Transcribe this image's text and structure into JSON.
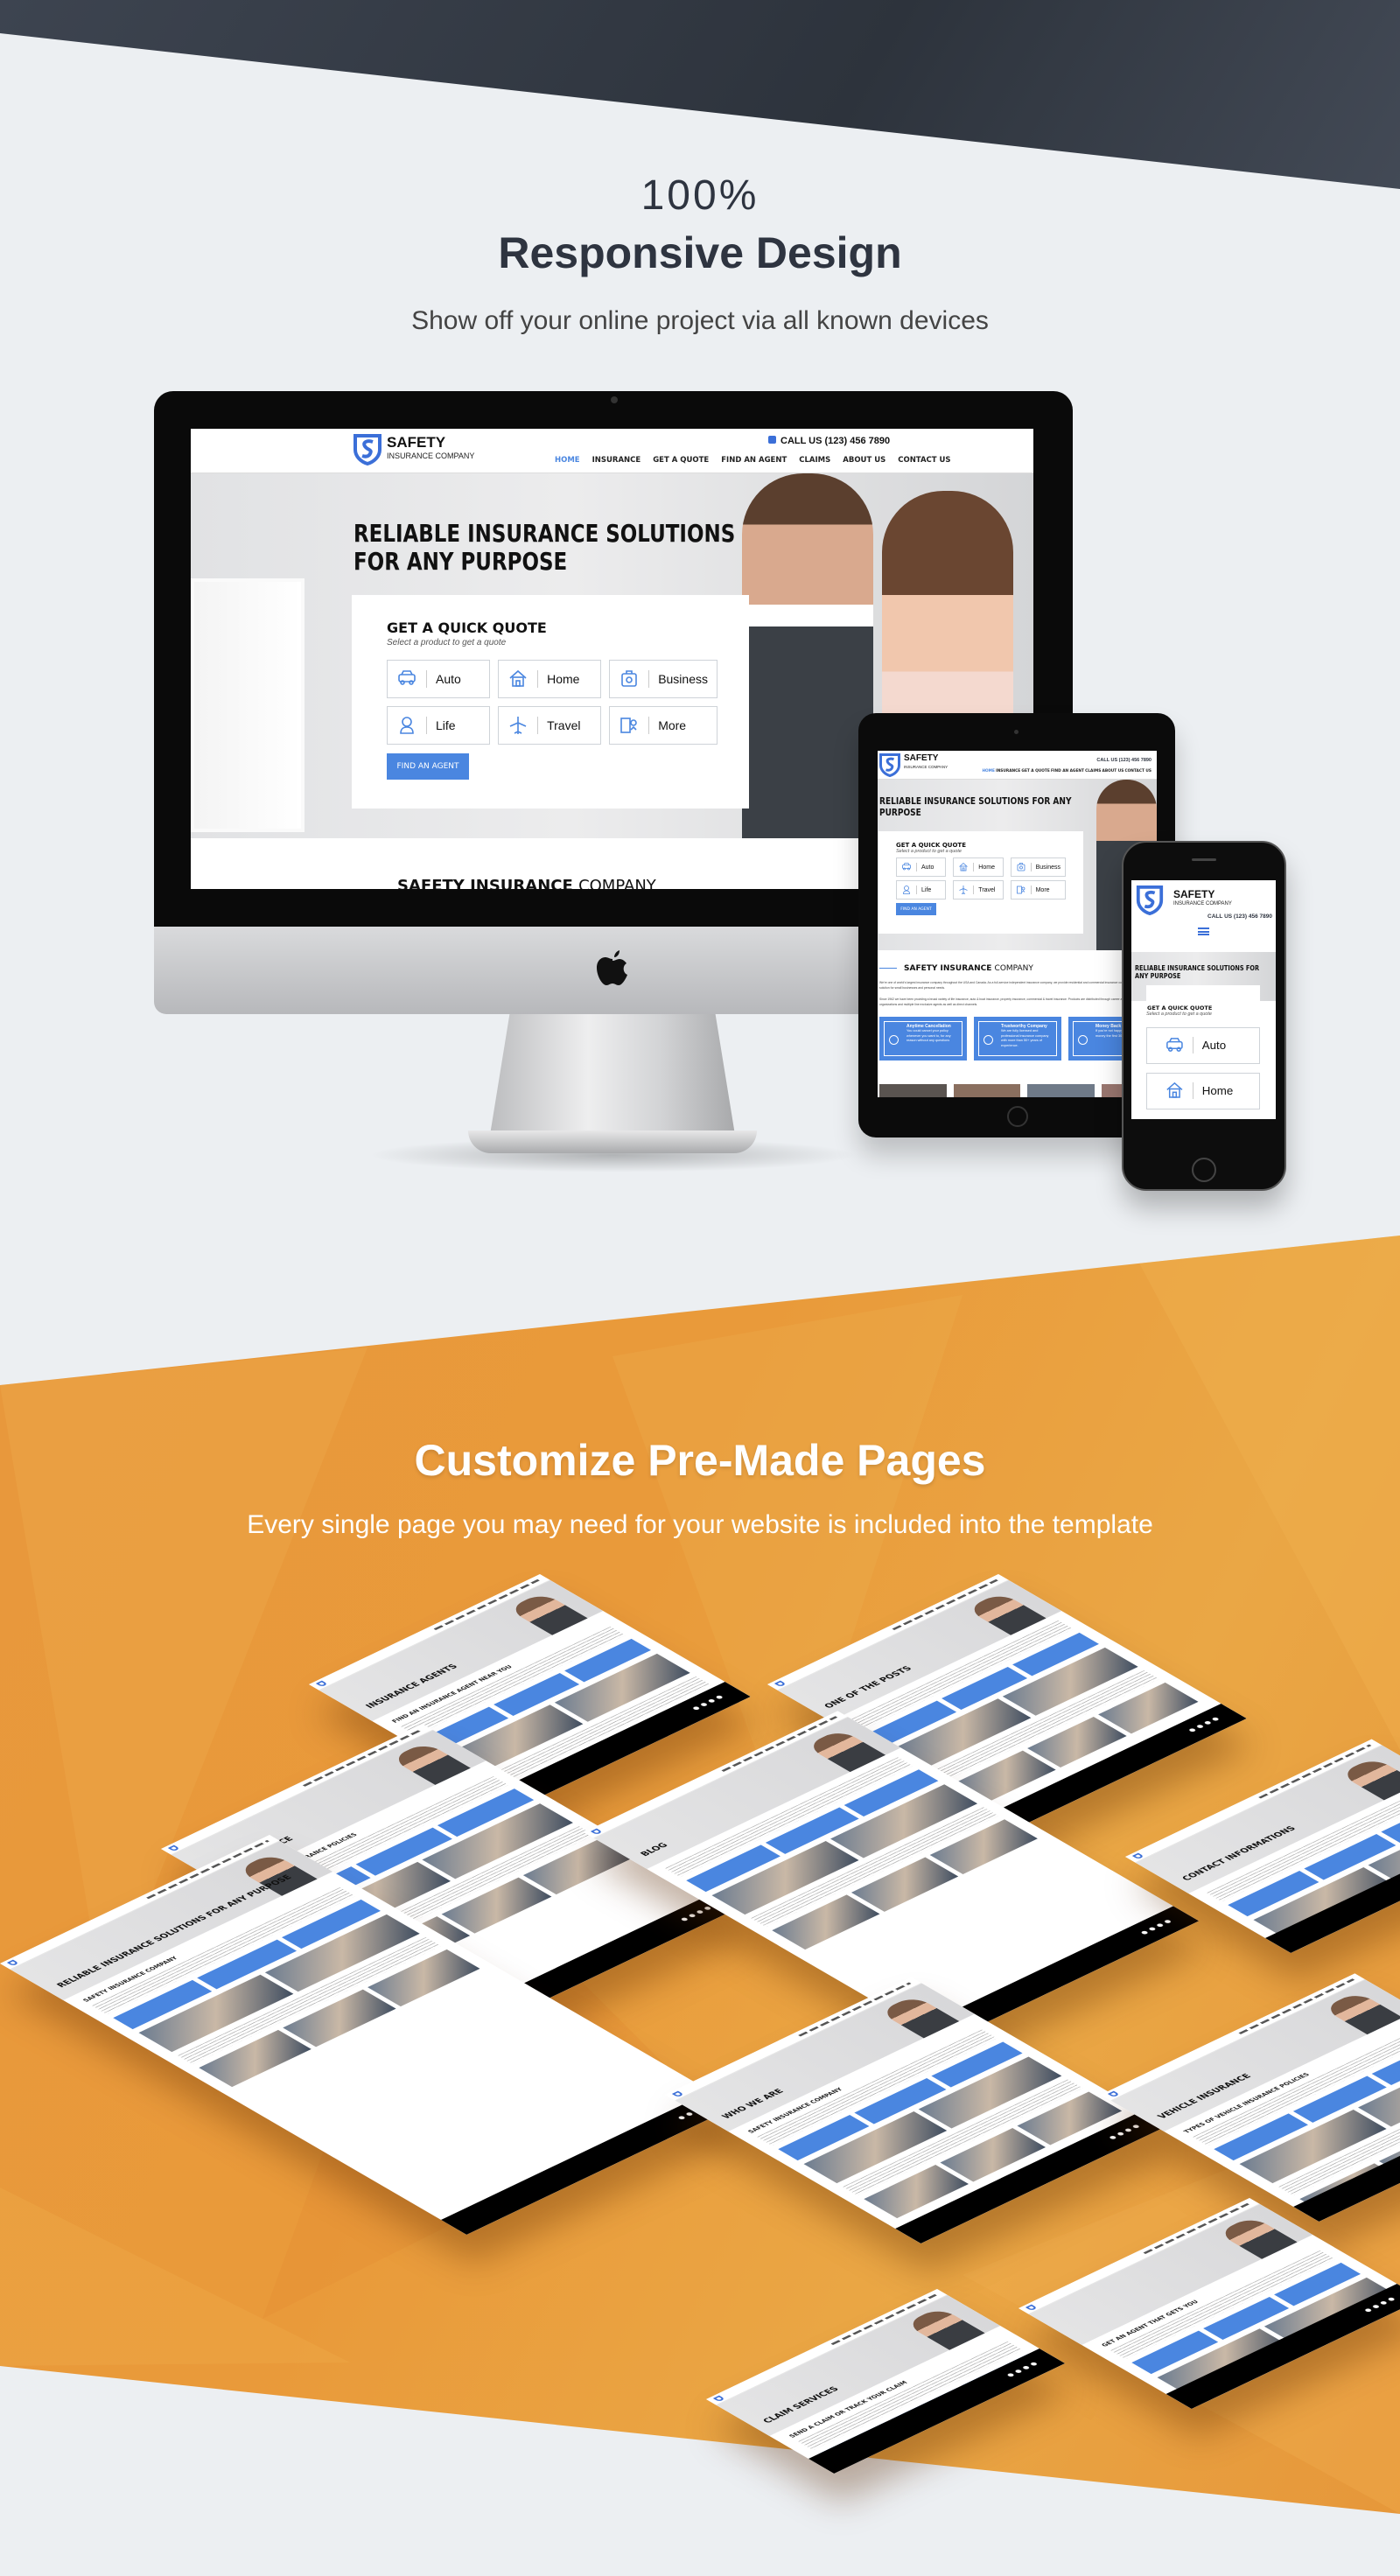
{
  "responsive": {
    "percent": "100%",
    "title": "Responsive Design",
    "subtitle": "Show off your online project via all known devices"
  },
  "site": {
    "logo_name": "SAFETY",
    "logo_sub": "INSURANCE COMPANY",
    "phone": "CALL US (123) 456 7890",
    "nav": [
      "HOME",
      "INSURANCE",
      "GET A QUOTE",
      "FIND AN AGENT",
      "CLAIMS",
      "ABOUT US",
      "CONTACT US"
    ],
    "hero_line1": "RELIABLE INSURANCE SOLUTIONS",
    "hero_line2": "FOR ANY PURPOSE",
    "hero_full": "RELIABLE INSURANCE SOLUTIONS FOR ANY PURPOSE",
    "quote_title": "GET A QUICK QUOTE",
    "quote_sub": "Select a product to get a quote",
    "products": [
      {
        "label": "Auto",
        "icon": "car-icon"
      },
      {
        "label": "Home",
        "icon": "house-icon"
      },
      {
        "label": "Business",
        "icon": "briefcase-icon"
      },
      {
        "label": "Life",
        "icon": "person-icon"
      },
      {
        "label": "Travel",
        "icon": "airplane-icon"
      },
      {
        "label": "More",
        "icon": "more-icon"
      }
    ],
    "agent_button": "FIND AN AGENT",
    "section_bold": "SAFETY INSURANCE",
    "section_light": "COMPANY",
    "para1": "We're one of world's largest insurance company throughout the USA and Canada. As a full-service independent insurance company, we provide residential and commercial insurance coverage and risk management solution for small businesses and personal needs.",
    "para2": "Since 1962 we have been providing a broad variety of life insurance, auto & boat insurance, property insurance, commercial & travel insurance. Products are distributed through career agents, independent marketing organizations and multiple line exclusive agents as well as direct channels.",
    "features": [
      {
        "title": "Anytime Cancellation",
        "text": "You could cancel your policy whenever you want to, for any reason without any questions"
      },
      {
        "title": "Trustworthy Company",
        "text": "We are fully licensed and professional insurance company with more than 50+ years of experience."
      },
      {
        "title": "Money Back",
        "text": "If you're not happy we refund your money the first 30 days"
      }
    ]
  },
  "colors": {
    "accent": "#4a86e0",
    "orange": "#e99a3a",
    "dark": "#2e3440",
    "background": "#eceff2"
  },
  "pages_section": {
    "title": "Customize Pre-Made Pages",
    "subtitle": "Every single page you may need for your website is included into the template",
    "pages": [
      {
        "title": "INSURANCE AGENTS",
        "subtitle": "FIND AN INSURANCE AGENT NEAR YOU"
      },
      {
        "title": "ONE OF THE POSTS",
        "subtitle": ""
      },
      {
        "title": "LIFE INSURANCE",
        "subtitle": "TYPES OF LIFE INSURANCE POLICIES"
      },
      {
        "title": "BLOG",
        "subtitle": ""
      },
      {
        "title": "CONTACT INFORMATIONS",
        "subtitle": ""
      },
      {
        "title": "RELIABLE INSURANCE SOLUTIONS FOR ANY PURPOSE",
        "subtitle": "SAFETY INSURANCE COMPANY"
      },
      {
        "title": "WHO WE ARE",
        "subtitle": "SAFETY INSURANCE COMPANY"
      },
      {
        "title": "VEHICLE INSURANCE",
        "subtitle": "TYPES OF VEHICLE INSURANCE POLICIES"
      },
      {
        "title": "",
        "subtitle": "GET AN AGENT THAT GETS YOU"
      },
      {
        "title": "CLAIM SERVICES",
        "subtitle": "SEND A CLAIM OR TRACK YOUR CLAIM"
      }
    ]
  }
}
